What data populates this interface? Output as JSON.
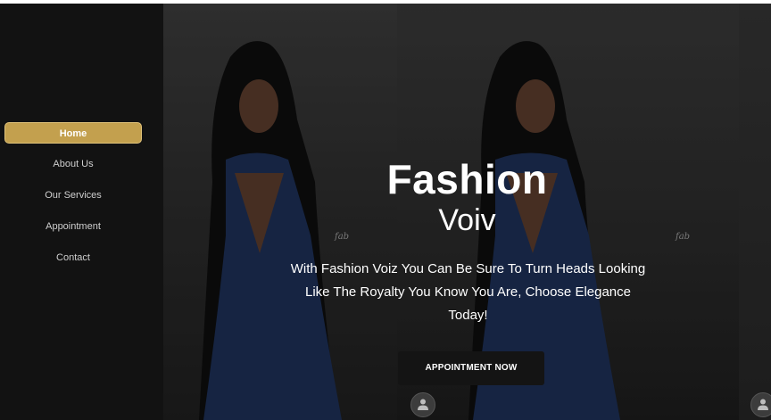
{
  "sidebar": {
    "items": [
      {
        "label": "Home",
        "active": true
      },
      {
        "label": "About Us"
      },
      {
        "label": "Our Services"
      },
      {
        "label": "Appointment"
      },
      {
        "label": "Contact"
      }
    ]
  },
  "hero": {
    "title": "Fashion",
    "subtitle": "Voiv",
    "tagline": "With Fashion Voiz You Can Be Sure To Turn Heads Looking Like The Royalty You Know You Are, Choose Elegance Today!",
    "cta_label": "APPOINTMENT NOW",
    "watermark": "fab"
  },
  "colors": {
    "accent": "#c3a04e",
    "sidebar_bg": "#121212",
    "cta_bg": "#141414"
  },
  "icons": [
    "user-icon"
  ]
}
